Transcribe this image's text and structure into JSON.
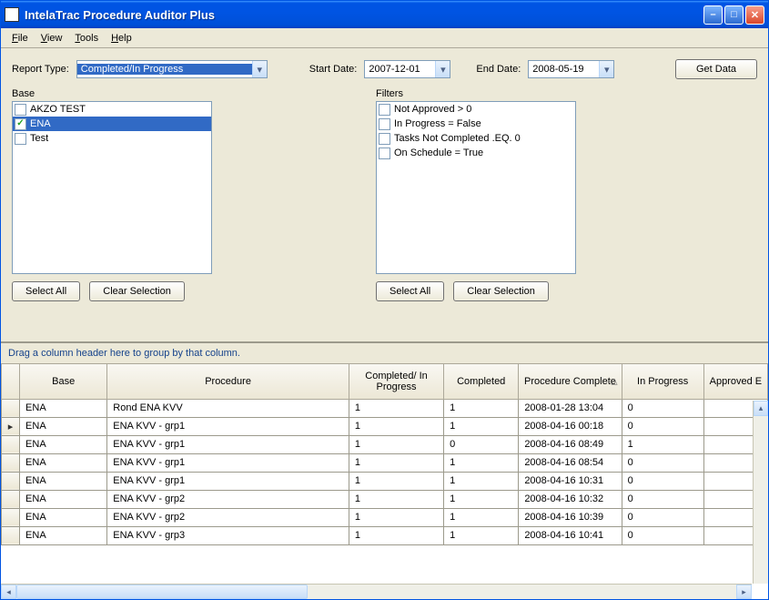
{
  "window": {
    "title": "IntelaTrac Procedure Auditor Plus"
  },
  "menu": {
    "file": "File",
    "view": "View",
    "tools": "Tools",
    "help": "Help"
  },
  "filters_row": {
    "report_type_label": "Report Type:",
    "report_type_value": "Completed/In Progress",
    "start_date_label": "Start Date:",
    "start_date_value": "2007-12-01",
    "end_date_label": "End Date:",
    "end_date_value": "2008-05-19",
    "get_data_label": "Get Data"
  },
  "base_panel": {
    "label": "Base",
    "items": [
      {
        "label": "AKZO TEST",
        "checked": false,
        "selected": false
      },
      {
        "label": "ENA",
        "checked": true,
        "selected": true
      },
      {
        "label": "Test",
        "checked": false,
        "selected": false
      }
    ],
    "select_all": "Select All",
    "clear": "Clear Selection"
  },
  "filters_panel": {
    "label": "Filters",
    "items": [
      {
        "label": "Not Approved > 0",
        "checked": false
      },
      {
        "label": "In Progress = False",
        "checked": false
      },
      {
        "label": "Tasks Not Completed .EQ. 0",
        "checked": false
      },
      {
        "label": "On Schedule = True",
        "checked": false
      }
    ],
    "select_all": "Select All",
    "clear": "Clear Selection"
  },
  "grid": {
    "group_hint": "Drag a column header here to group by that column.",
    "columns": [
      "Base",
      "Procedure",
      "Completed/ In Progress",
      "Completed",
      "Procedure Complete",
      "In Progress",
      "Approved E"
    ],
    "rows": [
      {
        "active": false,
        "base": "ENA",
        "procedure": "Rond ENA KVV",
        "cip": "1",
        "completed": "1",
        "pc": "2008-01-28 13:04",
        "ip": "0",
        "ae": ""
      },
      {
        "active": true,
        "base": "ENA",
        "procedure": "ENA KVV - grp1",
        "cip": "1",
        "completed": "1",
        "pc": "2008-04-16 00:18",
        "ip": "0",
        "ae": ""
      },
      {
        "active": false,
        "base": "ENA",
        "procedure": "ENA KVV - grp1",
        "cip": "1",
        "completed": "0",
        "pc": "2008-04-16 08:49",
        "ip": "1",
        "ae": ""
      },
      {
        "active": false,
        "base": "ENA",
        "procedure": "ENA KVV - grp1",
        "cip": "1",
        "completed": "1",
        "pc": "2008-04-16 08:54",
        "ip": "0",
        "ae": ""
      },
      {
        "active": false,
        "base": "ENA",
        "procedure": "ENA KVV - grp1",
        "cip": "1",
        "completed": "1",
        "pc": "2008-04-16 10:31",
        "ip": "0",
        "ae": ""
      },
      {
        "active": false,
        "base": "ENA",
        "procedure": "ENA KVV - grp2",
        "cip": "1",
        "completed": "1",
        "pc": "2008-04-16 10:32",
        "ip": "0",
        "ae": ""
      },
      {
        "active": false,
        "base": "ENA",
        "procedure": "ENA KVV - grp2",
        "cip": "1",
        "completed": "1",
        "pc": "2008-04-16 10:39",
        "ip": "0",
        "ae": ""
      },
      {
        "active": false,
        "base": "ENA",
        "procedure": "ENA KVV - grp3",
        "cip": "1",
        "completed": "1",
        "pc": "2008-04-16 10:41",
        "ip": "0",
        "ae": ""
      }
    ]
  }
}
